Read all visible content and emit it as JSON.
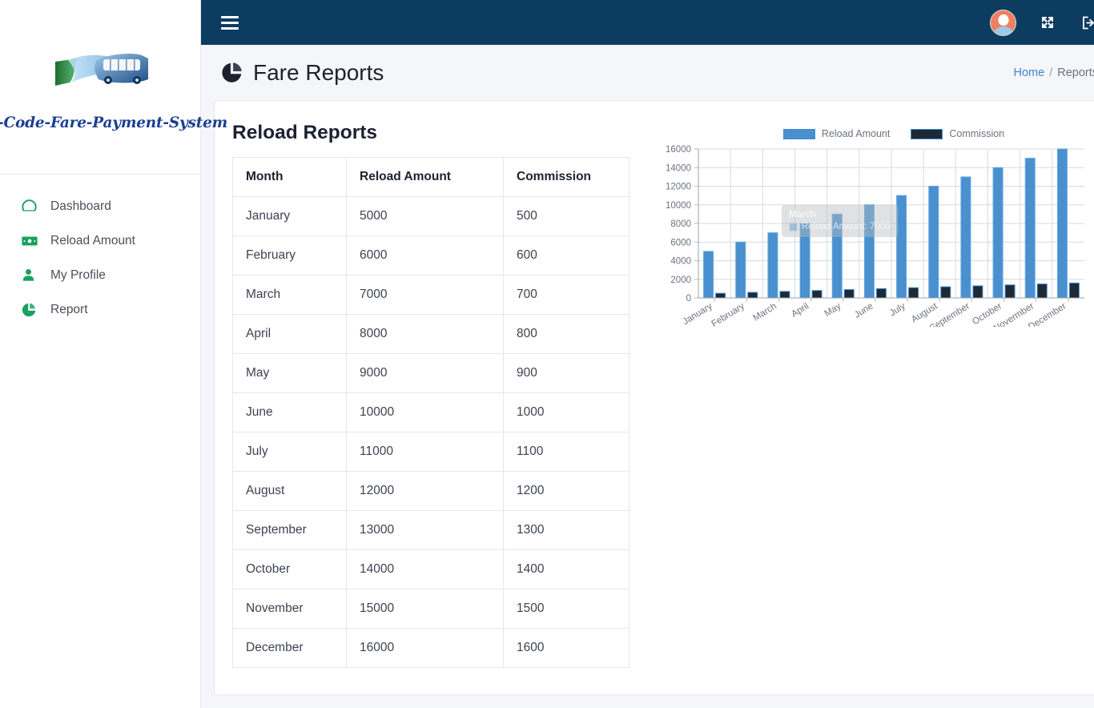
{
  "sidebar": {
    "brand_name": "QR-Code-Fare-Payment-System",
    "items": [
      {
        "label": "Dashboard",
        "icon": "tachometer-icon"
      },
      {
        "label": "Reload Amount",
        "icon": "money-bill-icon"
      },
      {
        "label": "My Profile",
        "icon": "user-icon"
      },
      {
        "label": "Report",
        "icon": "pie-chart-icon"
      }
    ]
  },
  "topbar": {
    "menu_icon": "hamburger-icon",
    "avatar_icon": "user-avatar-icon",
    "fullscreen_icon": "expand-arrows-icon",
    "logout_icon": "sign-out-icon"
  },
  "page": {
    "title": "Fare Reports",
    "title_icon": "pie-chart-icon",
    "breadcrumb": {
      "home": "Home",
      "separator": "/",
      "current": "Reports"
    }
  },
  "report": {
    "section_title": "Reload Reports",
    "columns": [
      "Month",
      "Reload Amount",
      "Commission"
    ],
    "rows": [
      [
        "January",
        "5000",
        "500"
      ],
      [
        "February",
        "6000",
        "600"
      ],
      [
        "March",
        "7000",
        "700"
      ],
      [
        "April",
        "8000",
        "800"
      ],
      [
        "May",
        "9000",
        "900"
      ],
      [
        "June",
        "10000",
        "1000"
      ],
      [
        "July",
        "11000",
        "1100"
      ],
      [
        "August",
        "12000",
        "1200"
      ],
      [
        "September",
        "13000",
        "1300"
      ],
      [
        "October",
        "14000",
        "1400"
      ],
      [
        "November",
        "15000",
        "1500"
      ],
      [
        "December",
        "16000",
        "1600"
      ]
    ]
  },
  "tooltip": {
    "title": "March",
    "label": "Reload Amount: 7000"
  },
  "colors": {
    "topbar": "#0d3c61",
    "sidebar_icon": "#19a15f",
    "brand_text": "#1c3f94",
    "link": "#3d86d0",
    "bar_reload": "#4a90cf",
    "bar_reload_border": "#3f8ed0",
    "bar_commission": "#1d2a36",
    "page_bg": "#f4f6f9"
  },
  "chart_data": {
    "type": "bar",
    "title": "",
    "xlabel": "",
    "ylabel": "",
    "ylim": [
      0,
      16000
    ],
    "yticks": [
      0,
      2000,
      4000,
      6000,
      8000,
      10000,
      12000,
      14000,
      16000
    ],
    "grid": true,
    "legend_position": "top",
    "categories": [
      "January",
      "February",
      "March",
      "April",
      "May",
      "June",
      "July",
      "August",
      "September",
      "October",
      "Novermber",
      "December"
    ],
    "series": [
      {
        "name": "Reload Amount",
        "color": "#4a90cf",
        "values": [
          5000,
          6000,
          7000,
          8000,
          9000,
          10000,
          11000,
          12000,
          13000,
          14000,
          15000,
          16000
        ]
      },
      {
        "name": "Commission",
        "color": "#1d2a36",
        "values": [
          500,
          600,
          700,
          800,
          900,
          1000,
          1100,
          1200,
          1300,
          1400,
          1500,
          1600
        ]
      }
    ]
  }
}
